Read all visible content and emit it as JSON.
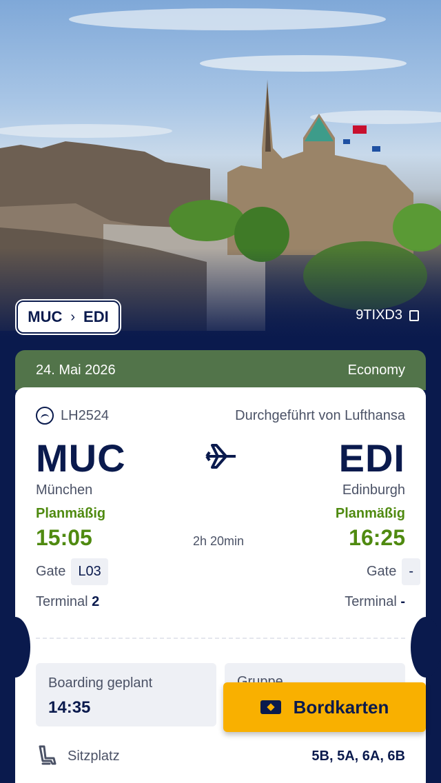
{
  "header": {
    "route_from": "MUC",
    "route_to": "EDI",
    "booking_code": "9TIXD3"
  },
  "ticket": {
    "date": "24. Mai 2026",
    "cabin_class": "Economy",
    "flight_number": "LH2524",
    "operated_by": "Durchgeführt von Lufthansa",
    "departure": {
      "iata": "MUC",
      "city": "München",
      "status": "Planmäßig",
      "time": "15:05",
      "gate_label": "Gate",
      "gate": "L03",
      "terminal_label": "Terminal",
      "terminal": "2"
    },
    "arrival": {
      "iata": "EDI",
      "city": "Edinburgh",
      "status": "Planmäßig",
      "time": "16:25",
      "gate_label": "Gate",
      "gate": "-",
      "terminal_label": "Terminal",
      "terminal": "-"
    },
    "duration": "2h 20min",
    "boarding_label": "Boarding geplant",
    "boarding_time": "14:35",
    "group_label": "Gruppe",
    "boarding_pass_button": "Bordkarten",
    "seat_label": "Sitzplatz",
    "seats": "5B, 5A, 6A, 6B"
  },
  "colors": {
    "navy": "#0a1a4d",
    "green_header": "#52744a",
    "status_green": "#4f8a10",
    "button_yellow": "#f9b000"
  },
  "icons": [
    "chevron-right-icon",
    "copy-icon",
    "lufthansa-crane-icon",
    "airplane-icon",
    "boarding-pass-icon",
    "seat-icon"
  ]
}
